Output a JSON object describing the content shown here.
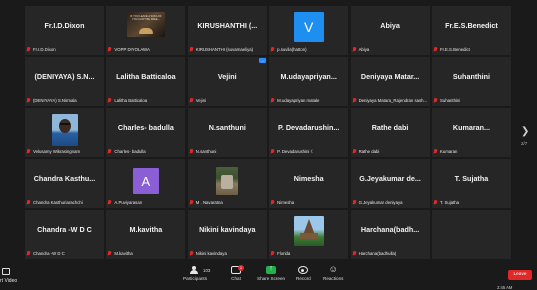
{
  "tiles": [
    {
      "name": "Fr.I.D.Dixon",
      "caption": "Fr.I.D.Dixon",
      "pic": ""
    },
    {
      "name": "",
      "caption": "VOPP DIYOLAWA",
      "pic": "book",
      "pic_text": "IF YOU LEAVE A SOFA OF YOU CAN'T BE FREE..."
    },
    {
      "name": "KIRUSHANTHI (...",
      "caption": "KIRUSHANTHI (suvarnaeliya)",
      "pic": ""
    },
    {
      "name": "",
      "caption": "p.suvila(hatton)",
      "pic": "avatar-v",
      "avatar_letter": "V"
    },
    {
      "name": "Abiya",
      "caption": "Abiya",
      "pic": ""
    },
    {
      "name": "Fr.E.S.Benedict",
      "caption": "Fr.E.S.Benedict",
      "pic": ""
    },
    {
      "name": "(DENIYAYA)  S.N...",
      "caption": "(DENIYAYA) S.Nirmala",
      "pic": ""
    },
    {
      "name": "Lalitha Batticaloa",
      "caption": "Lalitha Batticaloa",
      "pic": ""
    },
    {
      "name": "Vejini",
      "caption": "Vejini",
      "pic": "",
      "badge": "..."
    },
    {
      "name": "M.udayapriyan...",
      "caption": "M.udayapriyan matale",
      "pic": ""
    },
    {
      "name": "Deniyaya  Matar...",
      "caption": "Deniyaya Matara_Rajendran sash...",
      "pic": ""
    },
    {
      "name": "Suhanthini",
      "caption": "Suhanthini",
      "pic": ""
    },
    {
      "name": "",
      "caption": "Velusamy Wikrasingnam",
      "pic": "face"
    },
    {
      "name": "Charles- badulla",
      "caption": "Charles- badulla",
      "pic": ""
    },
    {
      "name": "N.santhuni",
      "caption": "N.santhuni",
      "pic": ""
    },
    {
      "name": "P. Devadarushin...",
      "caption": "P. Devadarushini ☾",
      "pic": ""
    },
    {
      "name": "Rathe dabi",
      "caption": "Rathe dabi",
      "pic": ""
    },
    {
      "name": "Kumaran...",
      "caption": "Kumaran",
      "pic": ""
    },
    {
      "name": "Chandra  Kasthu...",
      "caption": "Chandra Kasthuriarachchi",
      "pic": ""
    },
    {
      "name": "",
      "caption": "A.Puviyarasan",
      "pic": "avatar-a",
      "avatar_letter": "A"
    },
    {
      "name": "",
      "caption": "M . Navaratna",
      "pic": "garden"
    },
    {
      "name": "Nimesha",
      "caption": "Nimesha",
      "pic": ""
    },
    {
      "name": "G.Jeyakumar  de...",
      "caption": "G.Jeyakumar deniyaya",
      "pic": ""
    },
    {
      "name": "T. Sujatha",
      "caption": "T. Sujatha",
      "pic": ""
    },
    {
      "name": "Chandra -W D C",
      "caption": "Chandra -W D C",
      "pic": ""
    },
    {
      "name": "M.kavitha",
      "caption": "M.kavitha",
      "pic": ""
    },
    {
      "name": "Nikini kavindaya",
      "caption": "Nikini kavindaya",
      "pic": ""
    },
    {
      "name": "",
      "caption": "Florida",
      "pic": "temple"
    },
    {
      "name": "Harchana(badh...",
      "caption": "Harchana(badhulla)",
      "pic": ""
    },
    {
      "name": "",
      "caption": "",
      "pic": ""
    }
  ],
  "pagination": {
    "arrow": "❯",
    "indicator": "2/7"
  },
  "toolbar": {
    "left_label": "rt Video",
    "participants_label": "Participants",
    "participants_count": "103",
    "chat_label": "Chat",
    "chat_badge": "1",
    "share_label": "Share Screen",
    "record_label": "Record",
    "reactions_label": "Reactions",
    "leave_label": "Leave"
  },
  "clock": "2:45 AM",
  "colors": {
    "background": "#1a1a1a",
    "tile": "#262626",
    "muted_mic": "#e02828",
    "share": "#22b14c",
    "leave": "#e02828",
    "avatar_v": "#1f8ef1",
    "avatar_a": "#8a5fd6"
  }
}
